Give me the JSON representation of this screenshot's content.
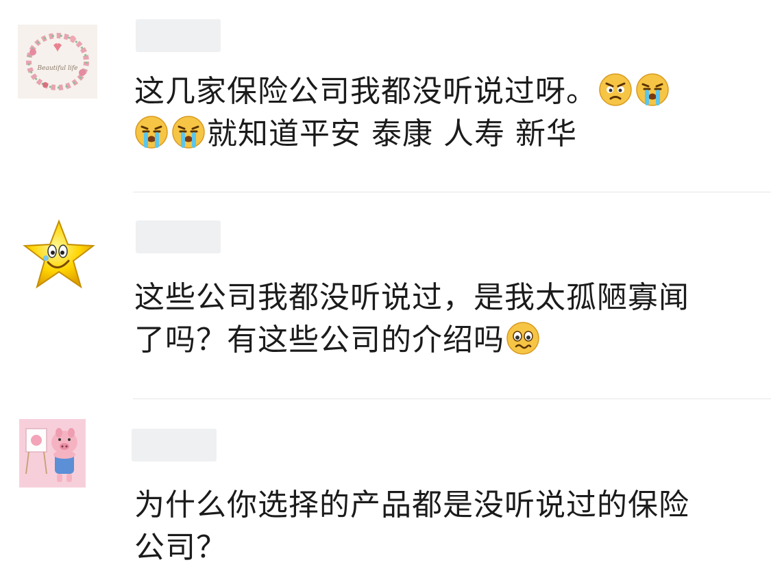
{
  "comments": [
    {
      "avatar_icon": "flower-wreath-avatar",
      "avatar_text": "Beautiful life",
      "line1": "这几家保险公司我都没听说过呀。",
      "line2": "就知道平安 泰康 人寿 新华",
      "emojis": [
        "angry-face-icon",
        "crying-face-icon",
        "crying-face-icon",
        "crying-face-icon"
      ]
    },
    {
      "avatar_icon": "smiling-star-avatar",
      "line1": "这些公司我都没听说过，是我太孤陋寡闻",
      "line2": "了吗？有这些公司的介绍吗",
      "emojis": [
        "worried-face-icon"
      ]
    },
    {
      "avatar_icon": "cartoon-pig-avatar",
      "line1": "为什么你选择的产品都是没听说过的保险",
      "line2": "公司？"
    }
  ],
  "colors": {
    "text": "#1b1b1b",
    "divider": "#e6e6e6",
    "name_placeholder": "#eef0f2"
  }
}
